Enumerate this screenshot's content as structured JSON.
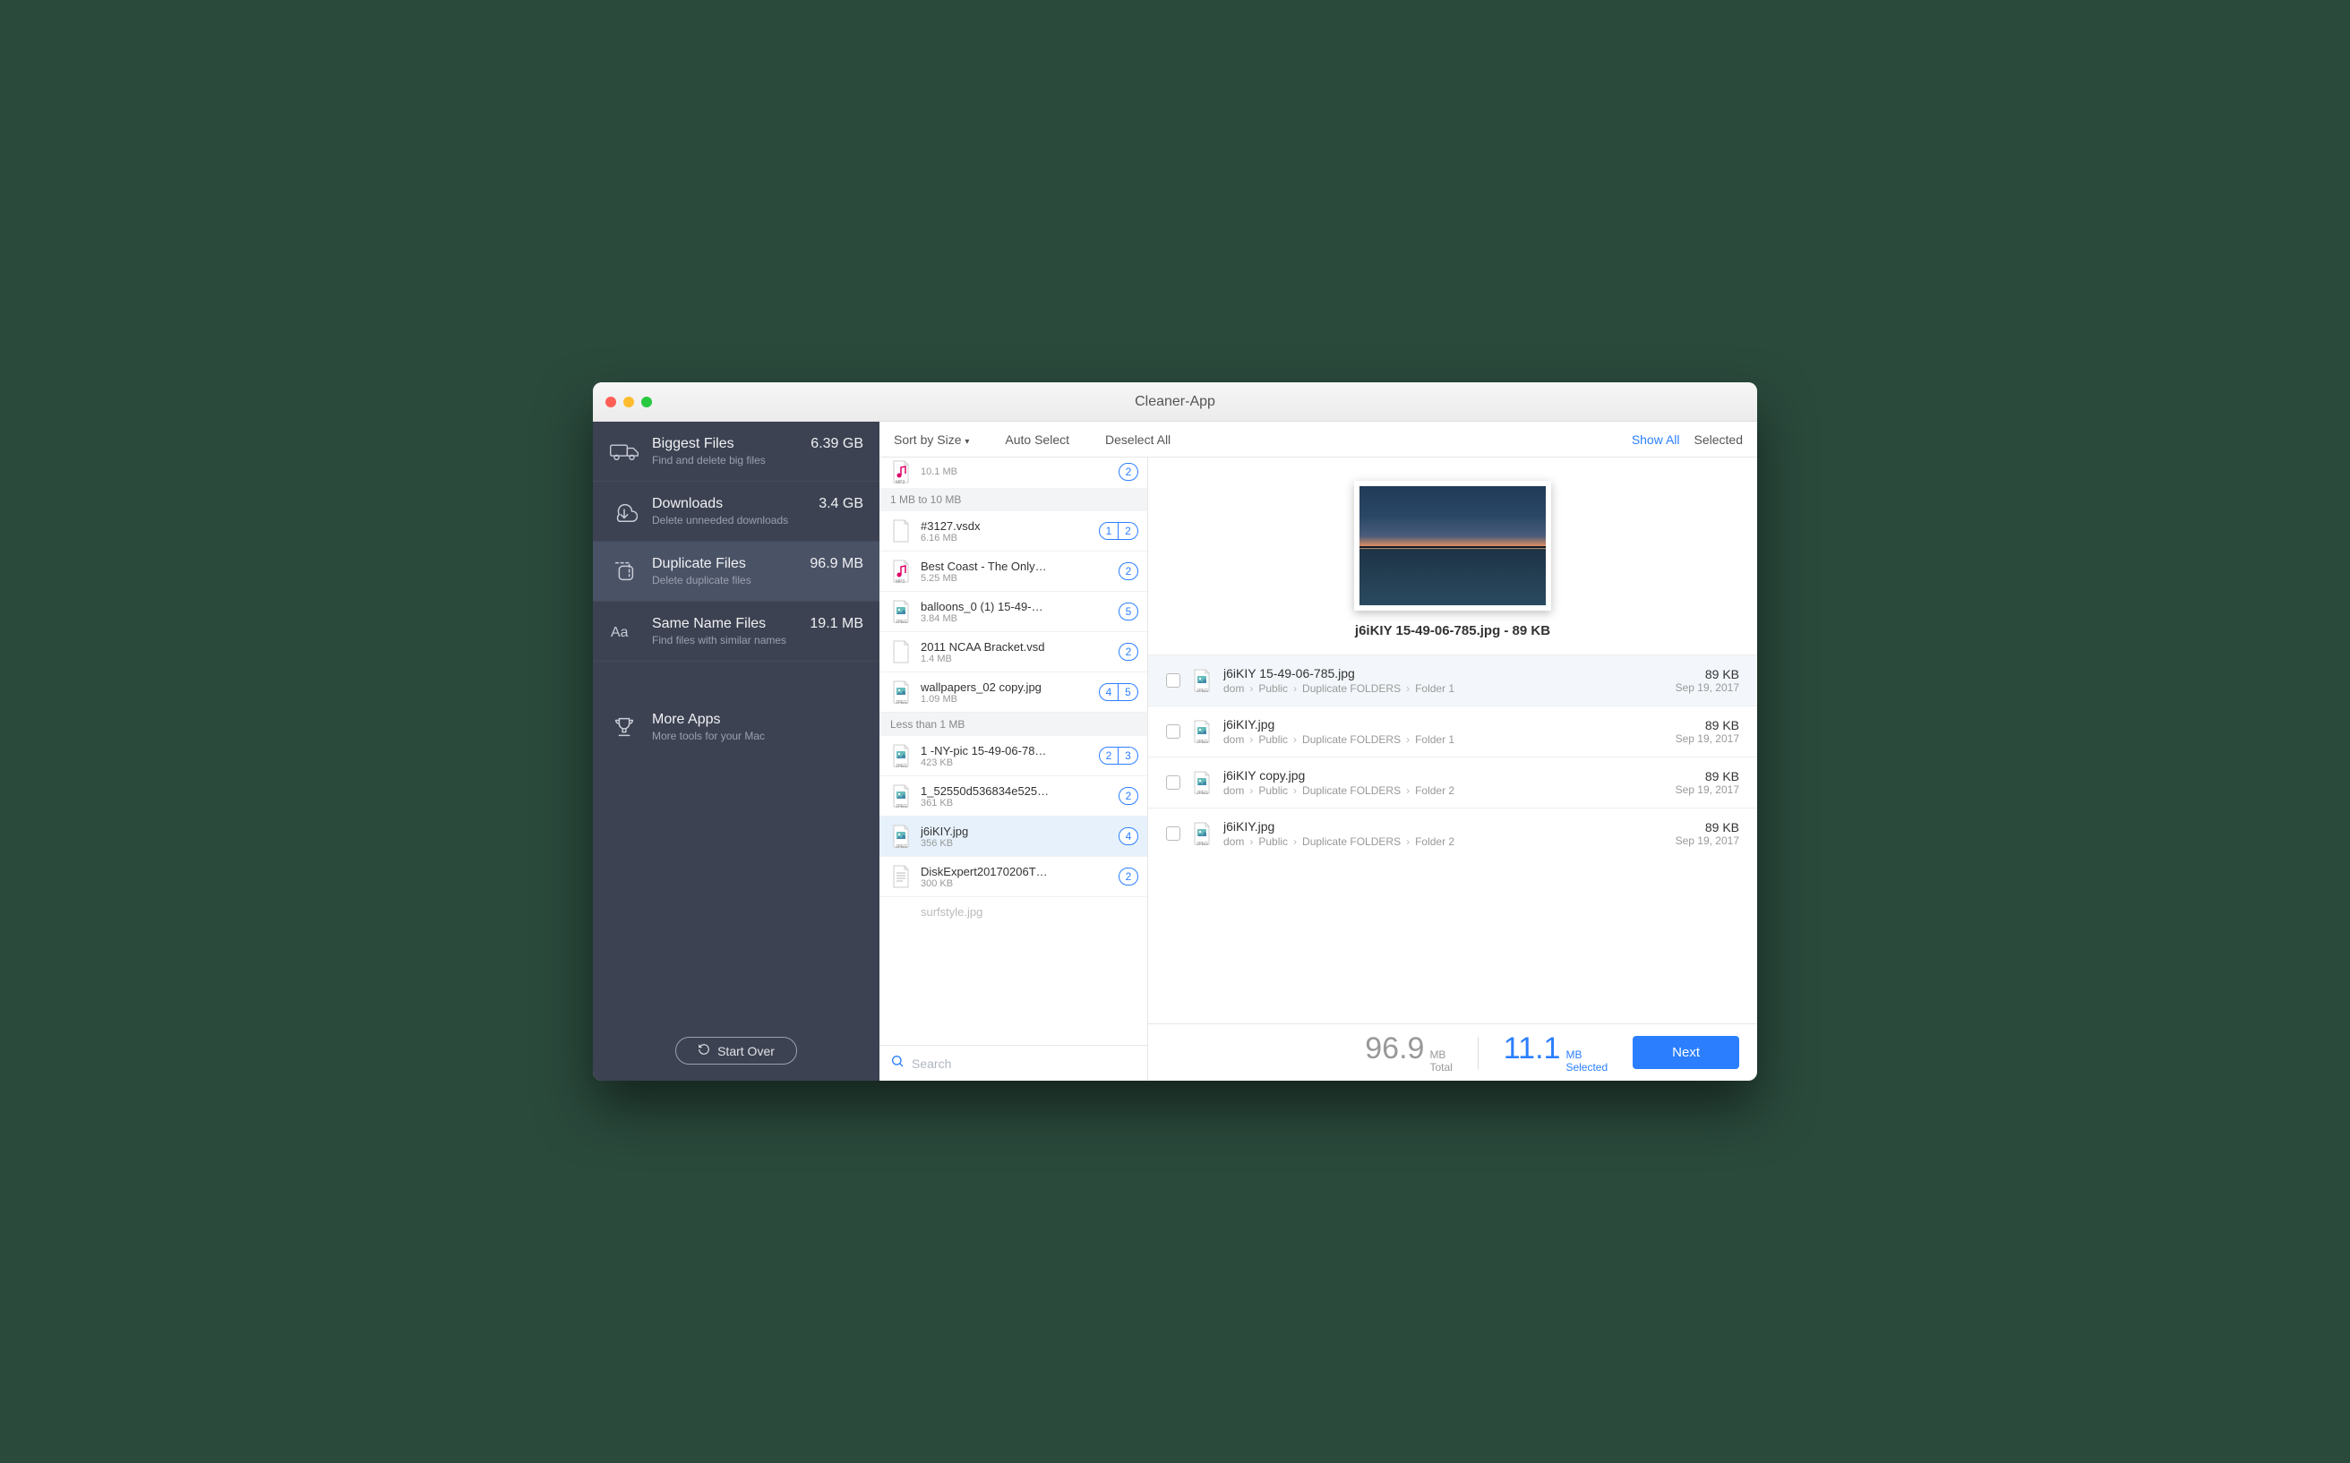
{
  "app": {
    "title": "Cleaner-App"
  },
  "sidebar": {
    "items": [
      {
        "title": "Biggest Files",
        "sub": "Find and delete big files",
        "size": "6.39 GB",
        "icon": "truck"
      },
      {
        "title": "Downloads",
        "sub": "Delete unneeded downloads",
        "size": "3.4 GB",
        "icon": "download"
      },
      {
        "title": "Duplicate Files",
        "sub": "Delete duplicate files",
        "size": "96.9 MB",
        "icon": "duplicate",
        "active": true
      },
      {
        "title": "Same Name Files",
        "sub": "Find files with similar names",
        "size": "19.1 MB",
        "icon": "samename"
      },
      {
        "title": "More Apps",
        "sub": "More tools for your Mac",
        "size": "",
        "icon": "trophy",
        "extra": true
      }
    ],
    "start_over": "Start Over"
  },
  "toolbar": {
    "sort": "Sort by Size",
    "auto_select": "Auto Select",
    "deselect_all": "Deselect All",
    "show_all": "Show All",
    "selected": "Selected"
  },
  "mid": {
    "top_truncated": {
      "size": "10.1 MB",
      "icon": "mp3",
      "badges": [
        "2"
      ]
    },
    "sections": [
      {
        "title": "1 MB to 10 MB",
        "files": [
          {
            "name": "#3127.vsdx",
            "size": "6.16 MB",
            "icon": "doc",
            "badges": [
              "1",
              "2"
            ]
          },
          {
            "name": "Best Coast - The Only…",
            "size": "5.25 MB",
            "icon": "mp3",
            "badges": [
              "2"
            ]
          },
          {
            "name": "balloons_0 (1) 15-49-…",
            "size": "3.84 MB",
            "icon": "jpeg",
            "badges": [
              "5"
            ]
          },
          {
            "name": "2011 NCAA Bracket.vsd",
            "size": "1.4 MB",
            "icon": "doc",
            "badges": [
              "2"
            ]
          },
          {
            "name": "wallpapers_02 copy.jpg",
            "size": "1.09 MB",
            "icon": "jpeg",
            "badges": [
              "4",
              "5"
            ]
          }
        ]
      },
      {
        "title": "Less than 1 MB",
        "files": [
          {
            "name": "1 -NY-pic 15-49-06-78…",
            "size": "423 KB",
            "icon": "jpeg",
            "badges": [
              "2",
              "3"
            ]
          },
          {
            "name": "1_52550d536834e525…",
            "size": "361 KB",
            "icon": "jpeg",
            "badges": [
              "2"
            ]
          },
          {
            "name": "j6iKIY.jpg",
            "size": "356 KB",
            "icon": "jpeg",
            "badges": [
              "4"
            ],
            "selected": true
          },
          {
            "name": "DiskExpert20170206T…",
            "size": "300 KB",
            "icon": "txt",
            "badges": [
              "2"
            ]
          }
        ]
      }
    ],
    "bottom_truncated_name": "surfstyle.jpg",
    "search_placeholder": "Search"
  },
  "detail": {
    "heading": "j6iKIY 15-49-06-785.jpg - 89 KB",
    "matches": [
      {
        "name": "j6iKIY 15-49-06-785.jpg",
        "path": [
          "dom",
          "Public",
          "Duplicate FOLDERS",
          "Folder 1"
        ],
        "size": "89 KB",
        "date": "Sep 19, 2017",
        "highlighted": true
      },
      {
        "name": "j6iKIY.jpg",
        "path": [
          "dom",
          "Public",
          "Duplicate FOLDERS",
          "Folder 1"
        ],
        "size": "89 KB",
        "date": "Sep 19, 2017"
      },
      {
        "name": "j6iKIY copy.jpg",
        "path": [
          "dom",
          "Public",
          "Duplicate FOLDERS",
          "Folder 2"
        ],
        "size": "89 KB",
        "date": "Sep 19, 2017"
      },
      {
        "name": "j6iKIY.jpg",
        "path": [
          "dom",
          "Public",
          "Duplicate FOLDERS",
          "Folder 2"
        ],
        "size": "89 KB",
        "date": "Sep 19, 2017"
      }
    ]
  },
  "footer": {
    "total_value": "96.9",
    "total_unit": "MB",
    "total_label": "Total",
    "sel_value": "11.1",
    "sel_unit": "MB",
    "sel_label": "Selected",
    "next": "Next"
  }
}
